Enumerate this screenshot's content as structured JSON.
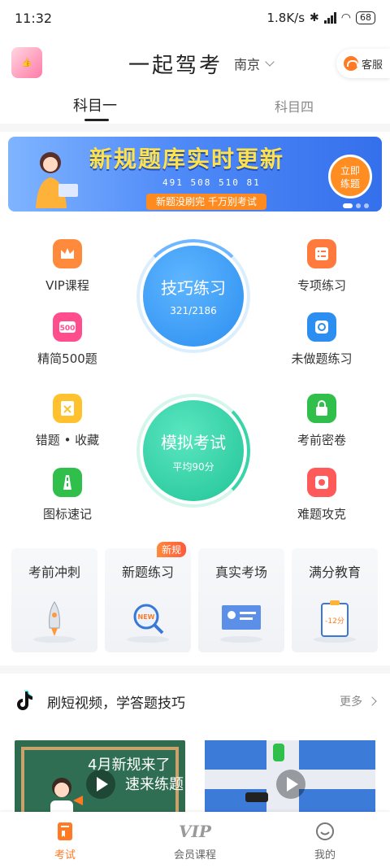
{
  "status_bar": {
    "time": "11:32",
    "network_speed": "1.8K/s",
    "battery": "68"
  },
  "header": {
    "app_title": "一起驾考",
    "city": "南京",
    "service_label": "客服"
  },
  "tabs": [
    {
      "label": "科目一",
      "active": true
    },
    {
      "label": "科目四",
      "active": false
    }
  ],
  "banner": {
    "title": "新规题库实时更新",
    "stats": "491 508 510 81",
    "subtitle": "新题没刷完  千万别考试",
    "button_line1": "立即",
    "button_line2": "练题"
  },
  "features": {
    "vip_course": "VIP课程",
    "topic_practice": "专项练习",
    "select_500": "精简500题",
    "undone_practice": "未做题练习",
    "wrong_fav": "错题 • 收藏",
    "secret_paper": "考前密卷",
    "sign_memory": "图标速记",
    "hard_questions": "难题攻克"
  },
  "skill_practice": {
    "title": "技巧练习",
    "progress": "321/2186"
  },
  "mock_exam": {
    "title": "模拟考试",
    "average": "平均90分"
  },
  "cards": [
    {
      "label": "考前冲刺",
      "badge": ""
    },
    {
      "label": "新题练习",
      "badge": "新规"
    },
    {
      "label": "真实考场",
      "badge": ""
    },
    {
      "label": "满分教育",
      "badge": ""
    }
  ],
  "card_extras": {
    "new_tag": "NEW",
    "score_tag": "-12分"
  },
  "video_section": {
    "title": "刷短视频，学答题技巧",
    "more": "更多",
    "video1_line1": "4月新规来了",
    "video1_line2": "速来练题"
  },
  "bottom_nav": [
    {
      "label": "考试",
      "active": true
    },
    {
      "label": "会员课程",
      "active": false
    },
    {
      "label": "我的",
      "active": false
    }
  ],
  "colors": {
    "accent": "#ff7a22",
    "skill_blue": "#3a9af0",
    "exam_green": "#2fd0a4"
  }
}
